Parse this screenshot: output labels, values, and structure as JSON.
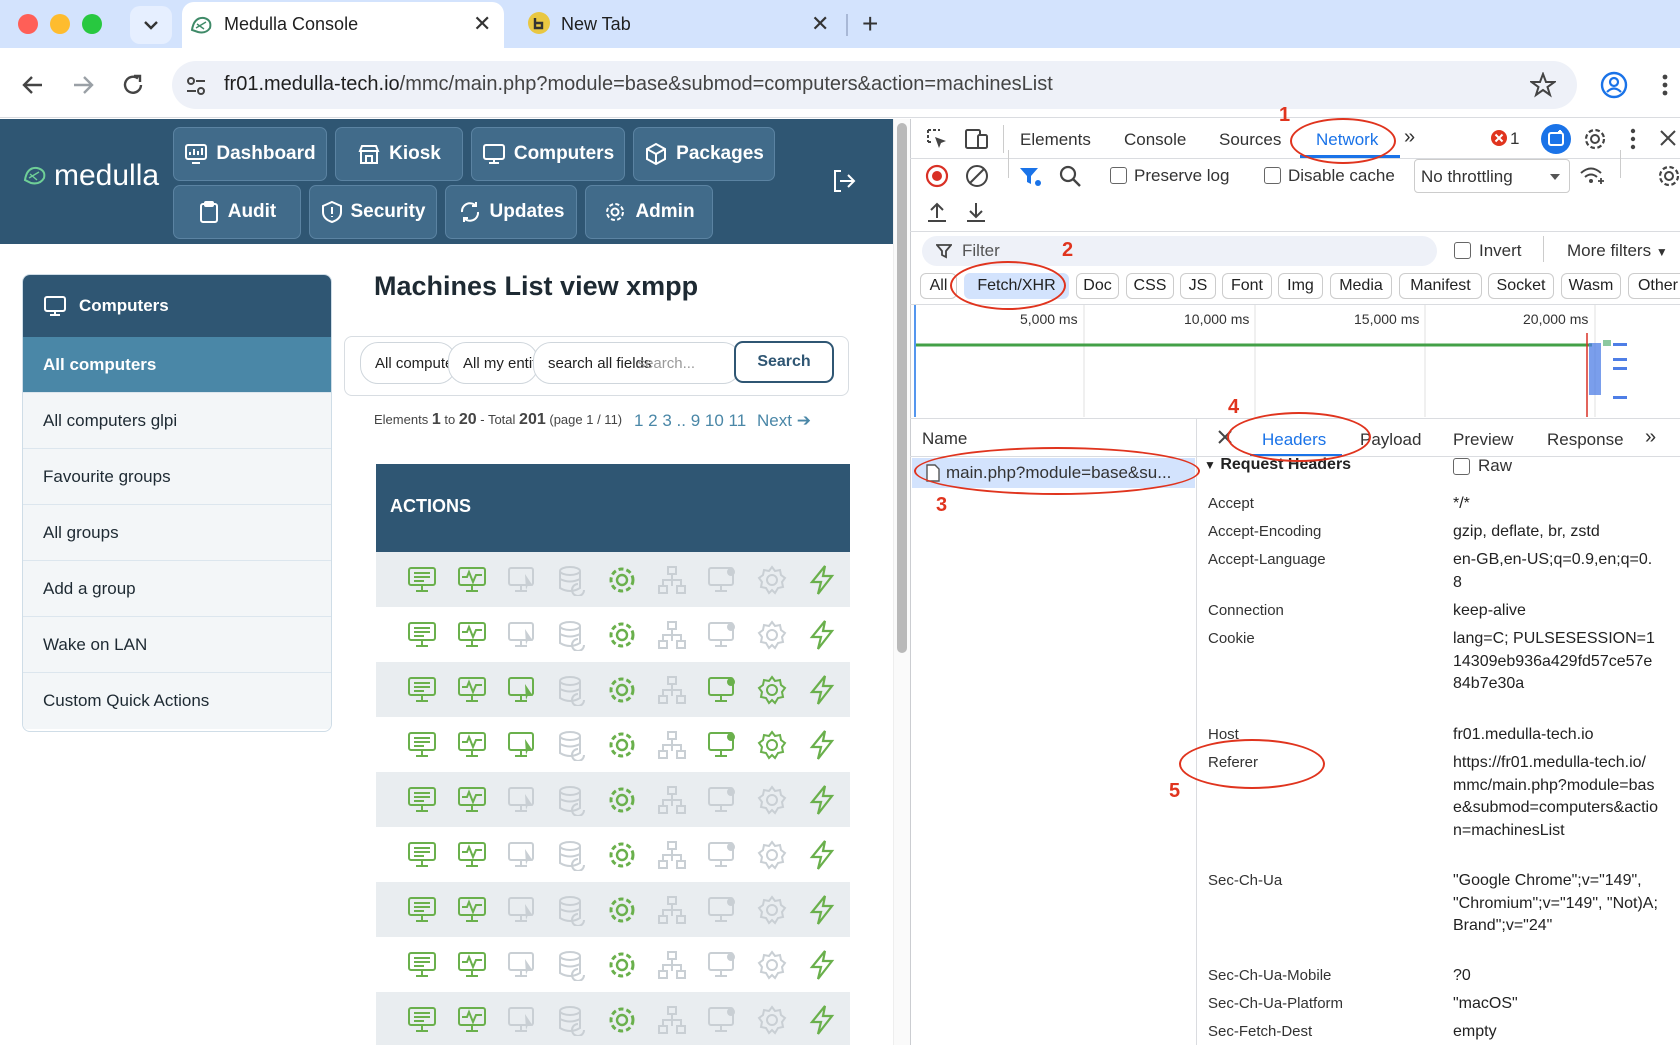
{
  "browser": {
    "tabs": [
      {
        "title": "Medulla Console"
      },
      {
        "title": "New Tab"
      }
    ],
    "url_host": "fr01.medulla-tech.io",
    "url_path": "/mmc/main.php?module=base&submod=computers&action=machinesList"
  },
  "app": {
    "logo_text": "medulla",
    "nav": [
      "Dashboard",
      "Kiosk",
      "Computers",
      "Packages",
      "Audit",
      "Security",
      "Updates",
      "Admin"
    ],
    "sidebar": {
      "header": "Computers",
      "items": [
        "All computers",
        "All computers glpi",
        "Favourite groups",
        "All groups",
        "Add a group",
        "Wake on LAN",
        "Custom Quick Actions"
      ]
    },
    "page_title": "Machines List view xmpp",
    "search": {
      "filter1": "All compute",
      "filter2": "All my entit",
      "field_label": "search all fields",
      "placeholder": "search...",
      "button": "Search"
    },
    "pager": {
      "prefix": "Elements",
      "from": "1",
      "to_word": "to",
      "to": "20",
      "total_word": "- Total",
      "total": "201",
      "page_info": "(page 1 / 11)",
      "pages": "1 2 3 .. 9 10 11",
      "next": "Next"
    },
    "actions_header": "ACTIONS",
    "action_rows_count": 9
  },
  "devtools": {
    "tabs": [
      "Elements",
      "Console",
      "Sources",
      "Network"
    ],
    "error_count": "1",
    "preserve_log": "Preserve log",
    "disable_cache": "Disable cache",
    "throttling": "No throttling",
    "filter_placeholder": "Filter",
    "invert": "Invert",
    "more_filters": "More filters",
    "type_filters": [
      "All",
      "Fetch/XHR",
      "Doc",
      "CSS",
      "JS",
      "Font",
      "Img",
      "Media",
      "Manifest",
      "Socket",
      "Wasm",
      "Other"
    ],
    "timeline_ticks": [
      "5,000 ms",
      "10,000 ms",
      "15,000 ms",
      "20,000 ms"
    ],
    "name_col": "Name",
    "request_name": "main.php?module=base&su...",
    "detail_tabs": [
      "Headers",
      "Payload",
      "Preview",
      "Response"
    ],
    "section_title": "Request Headers",
    "raw": "Raw",
    "headers": [
      {
        "k": "Accept",
        "v": "*/*"
      },
      {
        "k": "Accept-Encoding",
        "v": "gzip, deflate, br, zstd"
      },
      {
        "k": "Accept-Language",
        "v": "en-GB,en-US;q=0.9,en;q=0.8"
      },
      {
        "k": "Connection",
        "v": "keep-alive"
      },
      {
        "k": "Cookie",
        "v": "lang=C; PULSESESSION=114309eb936a429fd57ce57e84b7e30a"
      },
      {
        "k": "Host",
        "v": "fr01.medulla-tech.io"
      },
      {
        "k": "Referer",
        "v": "https://fr01.medulla-tech.io/mmc/main.php?module=base&submod=computers&action=machinesList"
      },
      {
        "k": "Sec-Ch-Ua",
        "v": "\"Google Chrome\";v=\"149\", \"Chromium\";v=\"149\", \"Not)A;Brand\";v=\"24\""
      },
      {
        "k": "Sec-Ch-Ua-Mobile",
        "v": "?0"
      },
      {
        "k": "Sec-Ch-Ua-Platform",
        "v": "\"macOS\""
      },
      {
        "k": "Sec-Fetch-Dest",
        "v": "empty"
      }
    ]
  },
  "annotations": [
    "1",
    "2",
    "3",
    "4",
    "5"
  ],
  "colors": {
    "brand": "#2f5673",
    "accent": "#4a87a7",
    "icon_green": "#6ab04c",
    "annotation": "#e0341e"
  }
}
